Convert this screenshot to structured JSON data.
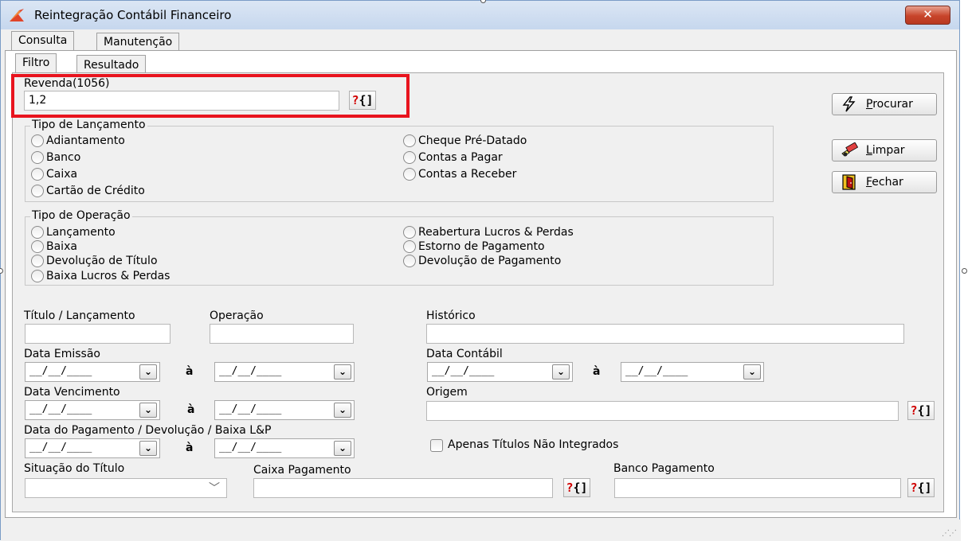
{
  "window": {
    "title": "Reintegração Contábil Financeiro",
    "close_label": "✕",
    "accent_color": "#e8141e"
  },
  "tabs_main": [
    {
      "label": "Consulta",
      "active": true
    },
    {
      "label": "Manutenção",
      "active": false
    }
  ],
  "tabs_sub": [
    {
      "label": "Filtro",
      "active": true
    },
    {
      "label": "Resultado",
      "active": false
    }
  ],
  "revenda": {
    "label": "Revenda(1056)",
    "value": "1,2",
    "lookup_q": "?",
    "lookup_b": "{]"
  },
  "tipo_lancamento": {
    "title": "Tipo de Lançamento",
    "options_left": [
      "Adiantamento",
      "Banco",
      "Caixa",
      "Cartão de Crédito"
    ],
    "options_right": [
      "Cheque Pré-Datado",
      "Contas a Pagar",
      "Contas a Receber"
    ]
  },
  "tipo_operacao": {
    "title": "Tipo de Operação",
    "options_left": [
      "Lançamento",
      "Baixa",
      "Devolução de Título",
      "Baixa Lucros & Perdas"
    ],
    "options_right": [
      "Reabertura Lucros & Perdas",
      "Estorno de Pagamento",
      "Devolução de Pagamento"
    ]
  },
  "buttons": {
    "procurar": {
      "accel": "P",
      "rest": "rocurar",
      "icon": "lightning-icon"
    },
    "limpar": {
      "accel": "L",
      "rest": "impar",
      "icon": "eraser-icon"
    },
    "fechar": {
      "accel": "F",
      "rest": "echar",
      "icon": "exit-door-icon"
    }
  },
  "fields": {
    "titulo_label": "Título / Lançamento",
    "operacao_label": "Operação",
    "historico_label": "Histórico",
    "data_emissao_label": "Data Emissão",
    "data_contabil_label": "Data Contábil",
    "data_vencimento_label": "Data Vencimento",
    "origem_label": "Origem",
    "data_pagamento_label": "Data do Pagamento / Devolução / Baixa L&P",
    "apenas_label": "Apenas Títulos Não Integrados",
    "situacao_label": "Situação do Título",
    "caixa_label": "Caixa Pagamento",
    "banco_label": "Banco Pagamento",
    "date_mask": "__/__/____",
    "range_sep": "à",
    "dropdown_glyph": "⌄",
    "combo_glyph": "﹀"
  }
}
